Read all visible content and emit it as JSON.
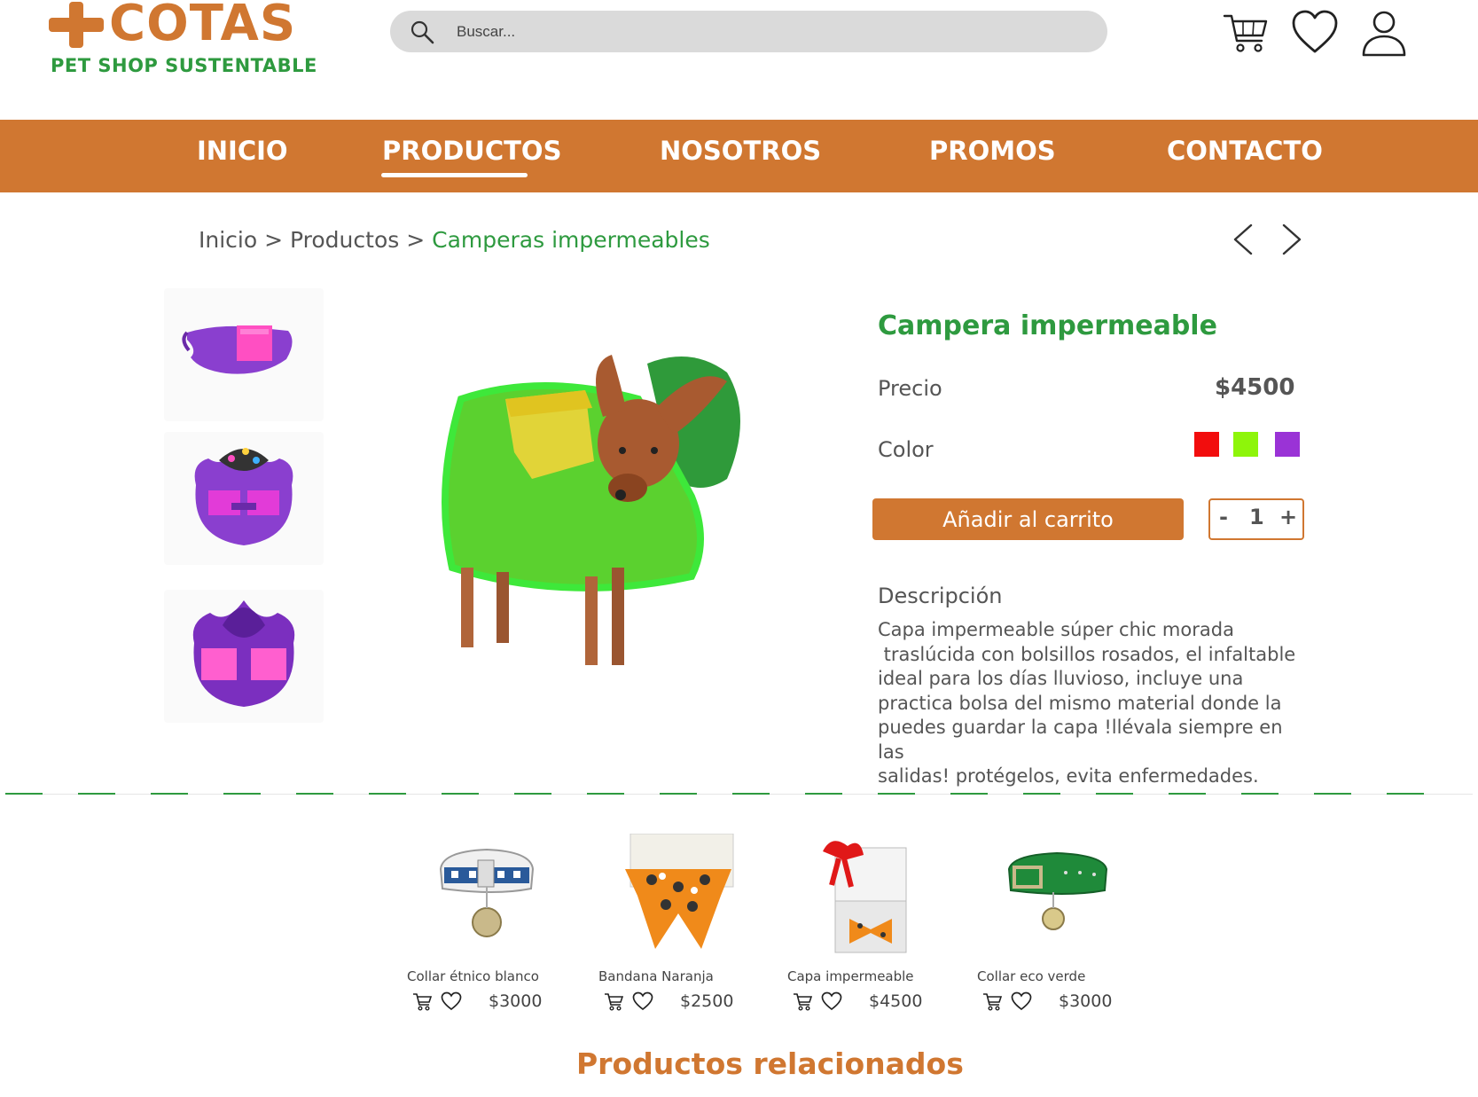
{
  "brand": {
    "name": "COTAS",
    "tagline": "PET SHOP SUSTENTABLE",
    "colors": {
      "orange": "#d07731",
      "green": "#2e9a3f"
    }
  },
  "header": {
    "search_placeholder": "Buscar...",
    "icons": [
      "search-icon",
      "cart-icon",
      "heart-icon",
      "user-icon"
    ]
  },
  "nav": {
    "items": [
      "INICIO",
      "PRODUCTOS",
      "NOSOTROS",
      "PROMOS",
      "CONTACTO"
    ],
    "active": "PRODUCTOS"
  },
  "breadcrumb": {
    "items": [
      "Inicio",
      "Productos"
    ],
    "separator": ">",
    "current": "Camperas impermeables"
  },
  "product": {
    "title": "Campera impermeable",
    "price_label": "Precio",
    "price": "$4500",
    "color_label": "Color",
    "colors": [
      "#f20d0d",
      "#8ef50a",
      "#9a33d6"
    ],
    "add_to_cart": "Añadir al carrito",
    "qty_minus": "-",
    "qty_value": "1",
    "qty_plus": "+",
    "desc_title": "Descripción",
    "desc_lines": [
      "Capa impermeable súper chic morada",
      " traslúcida con bolsillos rosados, el infaltable",
      "ideal para los días lluvioso, incluye una",
      "practica bolsa del mismo material donde la",
      "puedes guardar la capa !llévala siempre en las",
      "salidas! protégelos, evita enfermedades."
    ]
  },
  "related": {
    "title": "Productos relacionados",
    "items": [
      {
        "name": "Collar étnico blanco",
        "price": "$3000"
      },
      {
        "name": "Bandana Naranja",
        "price": "$2500"
      },
      {
        "name": "Capa impermeable",
        "price": "$4500"
      },
      {
        "name": "Collar eco verde",
        "price": "$3000"
      }
    ]
  }
}
